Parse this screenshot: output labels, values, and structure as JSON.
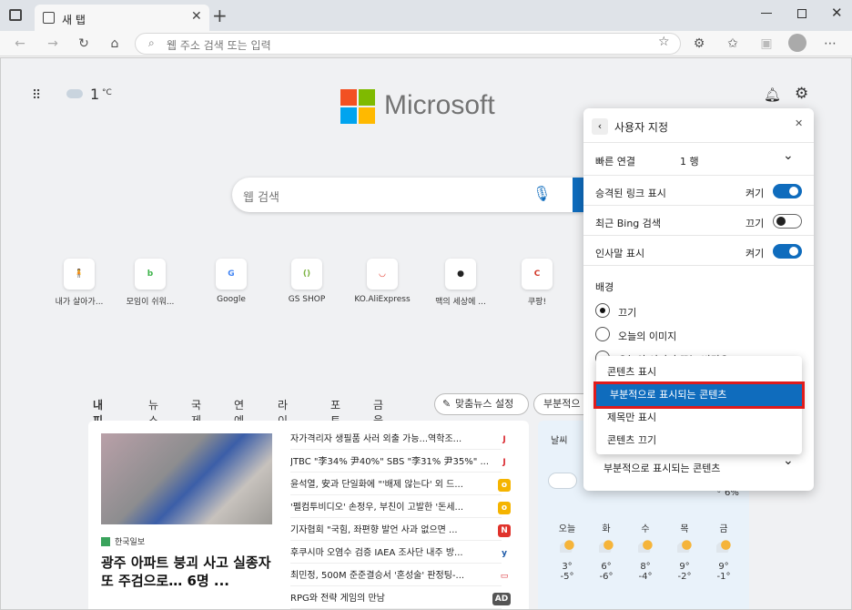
{
  "browser": {
    "tab_title": "새 탭",
    "address_placeholder": "웹 주소 검색 또는 입력"
  },
  "page": {
    "weather_temp": "1",
    "weather_unit": "°C",
    "logo_text": "Microsoft",
    "search_placeholder": "웹 검색",
    "quick_links": [
      {
        "label": "내가 살아가...",
        "glyph": "🧍",
        "color": "#c9a46b"
      },
      {
        "label": "모임이 쉬워...",
        "glyph": "b",
        "color": "#3db34a"
      },
      {
        "label": "Google",
        "glyph": "G",
        "color": "#4285f4"
      },
      {
        "label": "GS SHOP",
        "glyph": "()",
        "color": "#7cb342"
      },
      {
        "label": "KO.AliExpress",
        "glyph": "◡",
        "color": "#e43225"
      },
      {
        "label": "맥의 세상에 ...",
        "glyph": "●",
        "color": "#222222"
      },
      {
        "label": "쿠팡!",
        "glyph": "C",
        "color": "#d33b2c"
      }
    ],
    "feed_tabs": [
      "내 피드",
      "뉴스",
      "국제",
      "연예",
      "라이프",
      "포토",
      "금융"
    ],
    "custom_news_button": "맞춤뉴스 설정",
    "partial_button": "부분적으",
    "news": {
      "source": "한국일보",
      "headline": "광주 아파트 붕괴 사고 실종자 또 주검으로… 6명 ...",
      "items": [
        {
          "text": "자가격리자 생필품 사러 외출 가능...역학조...",
          "src": "J",
          "color": "#ffffff",
          "fg": "#d9282f"
        },
        {
          "text": "JTBC \"李34% 尹40%\" SBS \"李31% 尹35%\" ...",
          "src": "J",
          "color": "#ffffff",
          "fg": "#d9282f"
        },
        {
          "text": "윤석열, 安과 단일화에 \"'배제 않는다' 외 드...",
          "src": "o",
          "color": "#f5b400",
          "fg": "#ffffff"
        },
        {
          "text": "'펠컴투비디오' 손정우, 부친이 고발한 '돈세...",
          "src": "o",
          "color": "#f5b400",
          "fg": "#ffffff"
        },
        {
          "text": "기자협회 \"국힘, 좌편향 발언 사과 없으면 ...",
          "src": "N",
          "color": "#e0322b",
          "fg": "#ffffff"
        },
        {
          "text": "후쿠시마 오염수 검증 IAEA 조사단 내주 방...",
          "src": "y",
          "color": "#ffffff",
          "fg": "#1e5aa8"
        },
        {
          "text": "최민정, 500M 준준결승서 '혼성술' 판정팅-...",
          "src": "▭",
          "color": "#ffffff",
          "fg": "#d9282f"
        },
        {
          "text": "RPG와 전략 게임의 만남",
          "src": "AD",
          "color": "#555555",
          "fg": "#ffffff"
        }
      ]
    },
    "weather": {
      "title": "날씨",
      "precip": "6%",
      "days": [
        {
          "name": "오늘",
          "high": "3°",
          "low": "-5°"
        },
        {
          "name": "화",
          "high": "6°",
          "low": "-6°"
        },
        {
          "name": "수",
          "high": "8°",
          "low": "-4°"
        },
        {
          "name": "목",
          "high": "9°",
          "low": "-2°"
        },
        {
          "name": "금",
          "high": "9°",
          "low": "-1°"
        }
      ]
    }
  },
  "settings": {
    "title": "사용자 지정",
    "quick_links_label": "빠른 연결",
    "quick_links_value": "1 행",
    "toggles": [
      {
        "label": "승격된 링크 표시",
        "state": "켜기",
        "on": true
      },
      {
        "label": "최근 Bing 검색",
        "state": "끄기",
        "on": false
      },
      {
        "label": "인사말 표시",
        "state": "켜기",
        "on": true
      }
    ],
    "background_label": "배경",
    "background_options": [
      "끄기",
      "오늘의 이미지",
      "오늘의 이미지 또는 비디오"
    ],
    "content_value": "부분적으로 표시되는 콘텐츠"
  },
  "dropdown": {
    "options": [
      "콘텐츠 표시",
      "부분적으로 표시되는 콘텐츠",
      "제목만 표시",
      "콘텐츠 끄기"
    ],
    "selected": 1
  },
  "colors": {
    "accent": "#0f6cbd",
    "highlight_border": "#e01b1b"
  }
}
